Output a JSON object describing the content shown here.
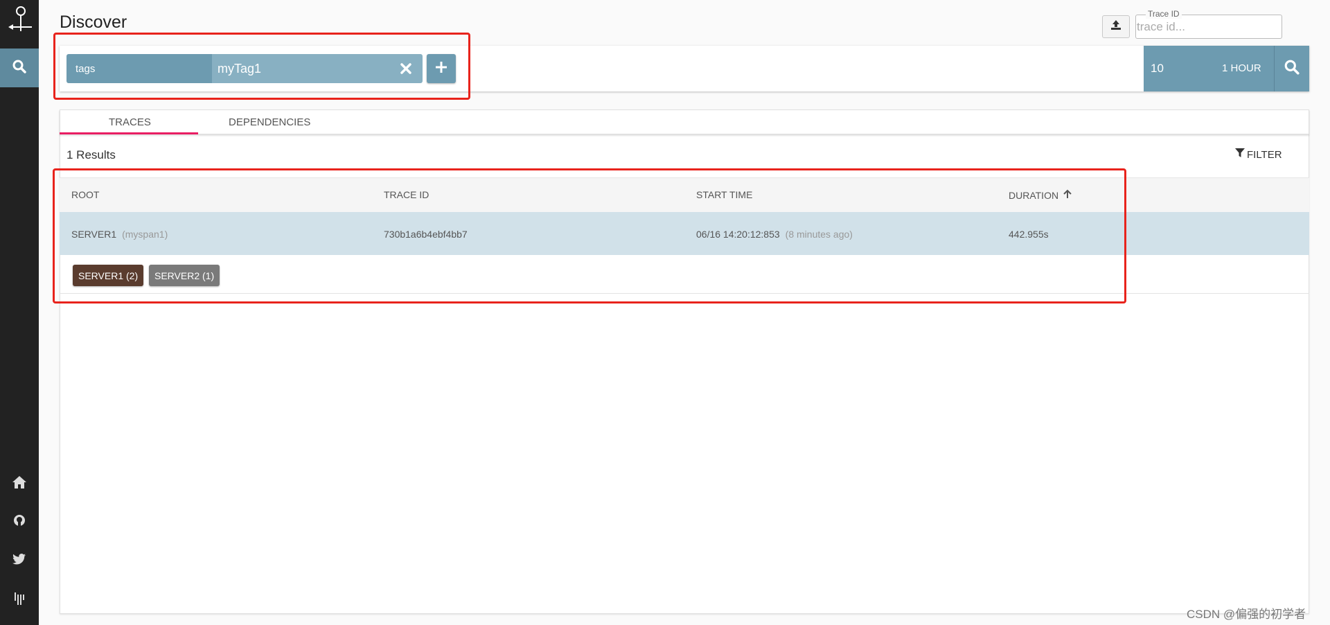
{
  "colors": {
    "sidebar_bg": "#222222",
    "accent": "#6d9bb0",
    "tab_underline": "#e91e63",
    "row_highlight": "#d1e1e9",
    "badge_server1": "#5a3c2e",
    "badge_server2": "#7a7a7a",
    "annotation": "#e8231c"
  },
  "sidebar": {
    "logo_icon": "zipkin-logo-icon",
    "active_item_icon": "search-icon",
    "bottom_icons": [
      "home-icon",
      "github-icon",
      "twitter-icon",
      "gitter-icon"
    ]
  },
  "header": {
    "title": "Discover",
    "trace_id_label": "Trace ID",
    "trace_id_placeholder": "trace id..."
  },
  "search": {
    "criteria": [
      {
        "key": "tags",
        "value": "myTag1"
      }
    ],
    "limit": "10",
    "lookback": "1 HOUR"
  },
  "tabs": [
    "TRACES",
    "DEPENDENCIES"
  ],
  "results": {
    "count_text": "1 Results",
    "filter_label": "FILTER",
    "columns": [
      "ROOT",
      "TRACE ID",
      "START TIME",
      "DURATION"
    ],
    "rows": [
      {
        "root": "SERVER1",
        "span": "(myspan1)",
        "trace_id": "730b1a6b4ebf4bb7",
        "start_time": "06/16 14:20:12:853",
        "relative_time": "(8 minutes ago)",
        "duration": "442.955s",
        "services": [
          {
            "label": "SERVER1 (2)"
          },
          {
            "label": "SERVER2 (1)"
          }
        ]
      }
    ]
  },
  "watermark": "CSDN @偏强的初学者"
}
